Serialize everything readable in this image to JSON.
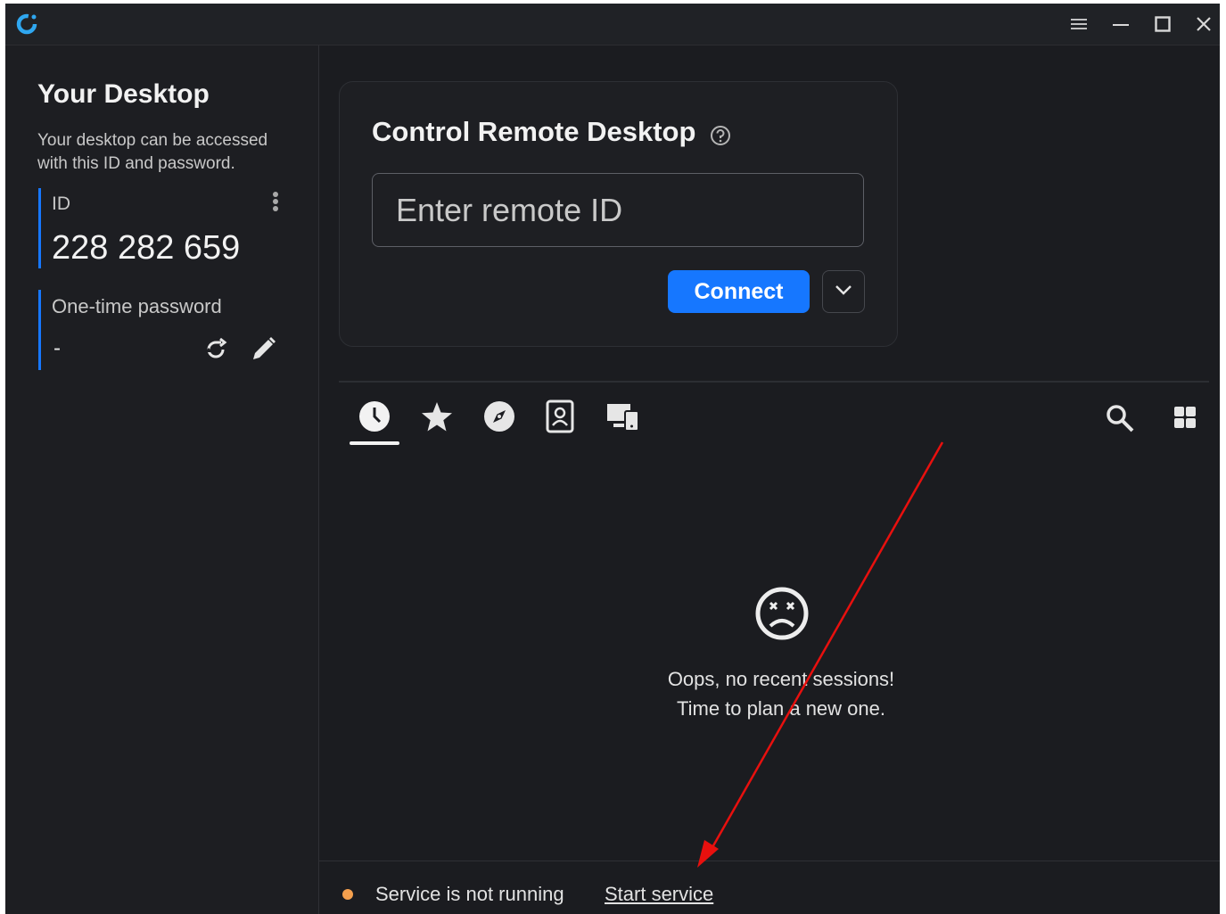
{
  "window": {
    "controls": [
      "menu-icon",
      "minimize-icon",
      "maximize-icon",
      "close-icon"
    ]
  },
  "sidebar": {
    "title": "Your Desktop",
    "description_line1": "Your desktop can be accessed",
    "description_line2": "with this ID and password.",
    "id_label": "ID",
    "id_value": "228 282 659",
    "password_label": "One-time password",
    "password_value": "-"
  },
  "connect_card": {
    "title": "Control Remote Desktop",
    "input_placeholder": "Enter remote ID",
    "input_value": "",
    "connect_label": "Connect"
  },
  "tabs": [
    {
      "icon": "history-icon",
      "active": true
    },
    {
      "icon": "star-icon",
      "active": false
    },
    {
      "icon": "discover-icon",
      "active": false
    },
    {
      "icon": "address-book-icon",
      "active": false
    },
    {
      "icon": "lan-devices-icon",
      "active": false
    }
  ],
  "empty_state": {
    "line1": "Oops, no recent sessions!",
    "line2": "Time to plan a new one."
  },
  "status": {
    "text": "Service is not running",
    "action_label": "Start service",
    "dot_color": "#f5a04e"
  },
  "colors": {
    "accent": "#1677ff",
    "id_bar": "#1677ff",
    "annotation_arrow": "#e8100e"
  }
}
